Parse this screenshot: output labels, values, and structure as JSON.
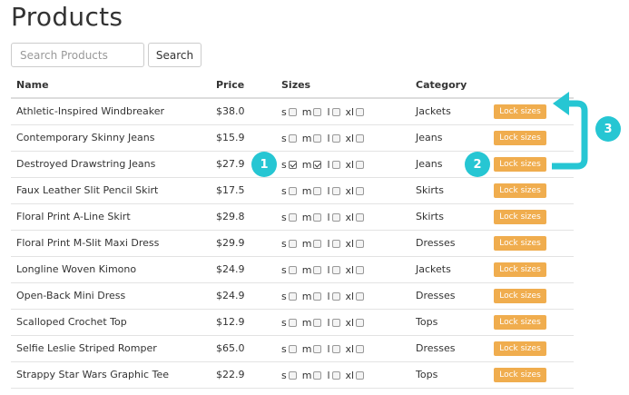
{
  "page": {
    "title": "Products"
  },
  "search": {
    "placeholder": "Search Products",
    "button_label": "Search"
  },
  "table": {
    "headers": {
      "name": "Name",
      "price": "Price",
      "sizes": "Sizes",
      "category": "Category"
    },
    "size_labels": [
      "s",
      "m",
      "l",
      "xl"
    ],
    "lock_label": "Lock sizes",
    "rows": [
      {
        "name": "Athletic-Inspired Windbreaker",
        "price": "$38.0",
        "category": "Jackets",
        "checked": [
          false,
          false,
          false,
          false
        ]
      },
      {
        "name": "Contemporary Skinny Jeans",
        "price": "$15.9",
        "category": "Jeans",
        "checked": [
          false,
          false,
          false,
          false
        ]
      },
      {
        "name": "Destroyed Drawstring Jeans",
        "price": "$27.9",
        "category": "Jeans",
        "checked": [
          true,
          true,
          false,
          false
        ]
      },
      {
        "name": "Faux Leather Slit Pencil Skirt",
        "price": "$17.5",
        "category": "Skirts",
        "checked": [
          false,
          false,
          false,
          false
        ]
      },
      {
        "name": "Floral Print A-Line Skirt",
        "price": "$29.8",
        "category": "Skirts",
        "checked": [
          false,
          false,
          false,
          false
        ]
      },
      {
        "name": "Floral Print M-Slit Maxi Dress",
        "price": "$29.9",
        "category": "Dresses",
        "checked": [
          false,
          false,
          false,
          false
        ]
      },
      {
        "name": "Longline Woven Kimono",
        "price": "$24.9",
        "category": "Jackets",
        "checked": [
          false,
          false,
          false,
          false
        ]
      },
      {
        "name": "Open-Back Mini Dress",
        "price": "$24.9",
        "category": "Dresses",
        "checked": [
          false,
          false,
          false,
          false
        ]
      },
      {
        "name": "Scalloped Crochet Top",
        "price": "$12.9",
        "category": "Tops",
        "checked": [
          false,
          false,
          false,
          false
        ]
      },
      {
        "name": "Selfie Leslie Striped Romper",
        "price": "$65.0",
        "category": "Dresses",
        "checked": [
          false,
          false,
          false,
          false
        ]
      },
      {
        "name": "Strappy Star Wars Graphic Tee",
        "price": "$22.9",
        "category": "Tops",
        "checked": [
          false,
          false,
          false,
          false
        ]
      }
    ]
  },
  "annotations": {
    "step1": "1",
    "step2": "2",
    "step3": "3"
  },
  "colors": {
    "lock_button": "#f0ad4e",
    "annotation": "#26c6d3"
  }
}
